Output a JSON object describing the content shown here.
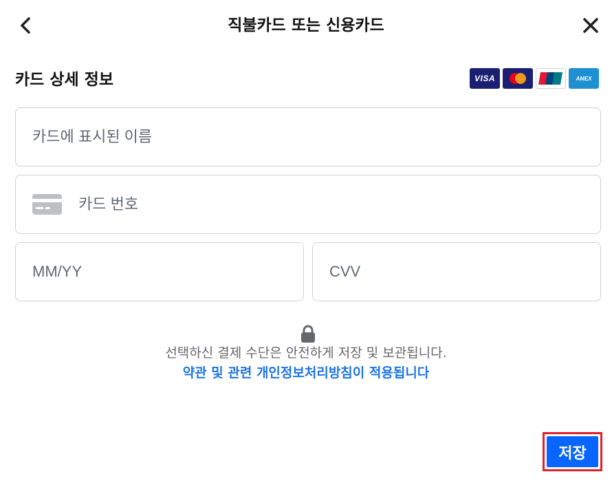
{
  "header": {
    "title": "직불카드 또는 신용카드",
    "back_icon": "chevron-left-icon",
    "close_icon": "close-icon"
  },
  "section": {
    "title": "카드 상세 정보"
  },
  "brands": {
    "visa_label": "VISA",
    "amex_label": "AMEX",
    "items": [
      "visa-logo",
      "mastercard-logo",
      "unionpay-logo",
      "amex-logo"
    ]
  },
  "fields": {
    "name_placeholder": "카드에 표시된 이름",
    "number_placeholder": "카드 번호",
    "expiry_placeholder": "MM/YY",
    "cvv_placeholder": "CVV",
    "card_icon": "credit-card-icon"
  },
  "security": {
    "icon": "lock-icon",
    "text": "선택하신 결제 수단은 안전하게 저장 및 보관됩니다.",
    "policy_link": "약관 및 관련 개인정보처리방침이 적용됩니다"
  },
  "actions": {
    "save_label": "저장"
  },
  "colors": {
    "primary": "#0866ff",
    "link": "#1b74e4",
    "highlight_border": "#e0202a",
    "field_border": "#ccd0d5",
    "muted_text": "#65676b"
  }
}
